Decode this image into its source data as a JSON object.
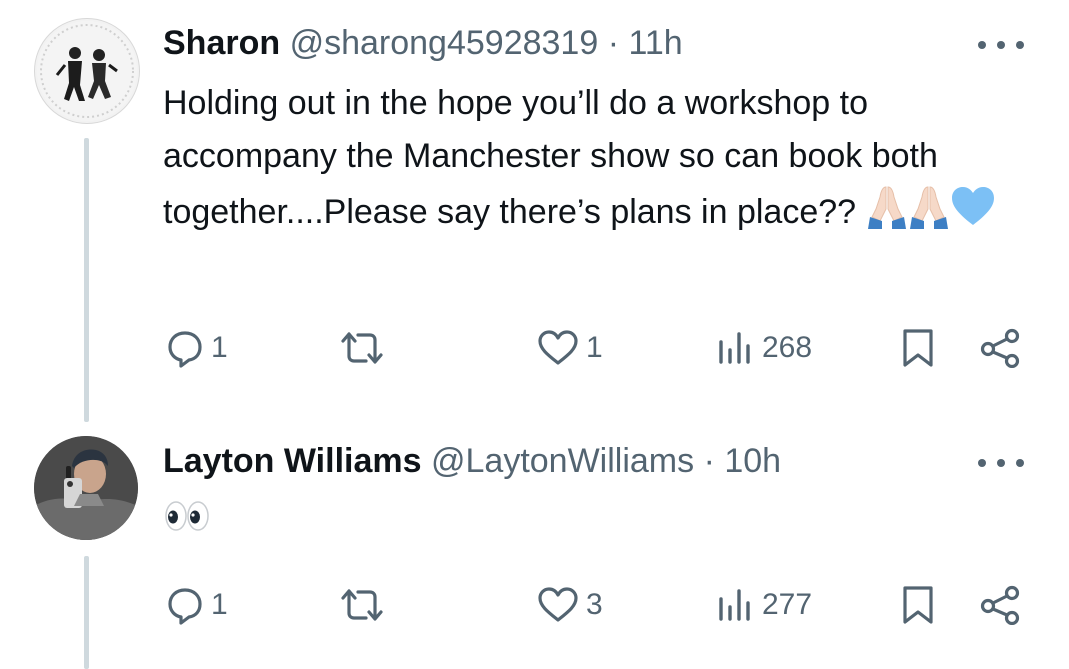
{
  "tweets": [
    {
      "name": "Sharon",
      "handle": "@sharong45928319",
      "separator": "·",
      "time": "11h",
      "text": "Holding out in the hope you’ll do a workshop to accompany the Manchester show so can book both together....Please say there’s plans in place??",
      "emojis": [
        "folded-hands",
        "folded-hands",
        "light-blue-heart"
      ],
      "replies": "1",
      "retweets": "",
      "likes": "1",
      "views": "268"
    },
    {
      "name": "Layton Williams",
      "handle": "@LaytonWilliams",
      "separator": "·",
      "time": "10h",
      "text": "",
      "emojis": [
        "eyes"
      ],
      "replies": "1",
      "retweets": "",
      "likes": "3",
      "views": "277"
    }
  ],
  "icons": {
    "reply": "reply-icon",
    "retweet": "retweet-icon",
    "like": "heart-icon",
    "views": "views-icon",
    "bookmark": "bookmark-icon",
    "share": "share-icon",
    "more": "more-icon"
  },
  "colors": {
    "text": "#0f1419",
    "secondary": "#536471",
    "thread_line": "#cfd9de",
    "heart_emoji": "#7cc0f5"
  }
}
